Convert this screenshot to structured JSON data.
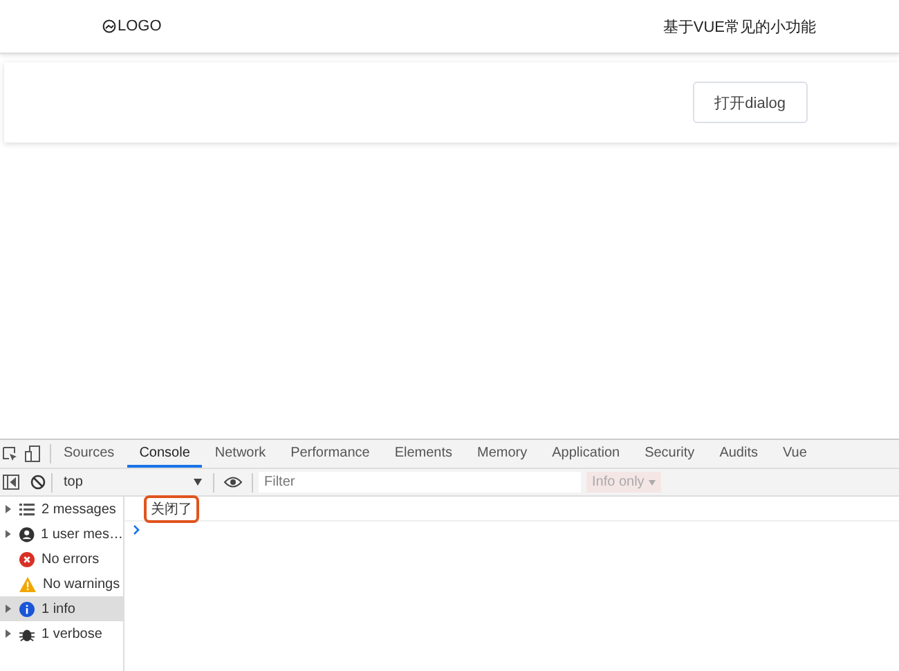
{
  "header": {
    "logo": "LOGO",
    "title": "基于VUE常见的小功能"
  },
  "card": {
    "button": "打开dialog"
  },
  "devtools": {
    "tabs": [
      {
        "label": "Sources",
        "selected": false
      },
      {
        "label": "Console",
        "selected": true
      },
      {
        "label": "Network",
        "selected": false
      },
      {
        "label": "Performance",
        "selected": false
      },
      {
        "label": "Elements",
        "selected": false
      },
      {
        "label": "Memory",
        "selected": false
      },
      {
        "label": "Application",
        "selected": false
      },
      {
        "label": "Security",
        "selected": false
      },
      {
        "label": "Audits",
        "selected": false
      },
      {
        "label": "Vue",
        "selected": false
      }
    ],
    "context": "top",
    "filter": {
      "placeholder": "Filter"
    },
    "levels": "Info only",
    "sidebar": [
      {
        "kind": "list",
        "label": "2 messages",
        "expandable": true,
        "selected": false
      },
      {
        "kind": "user",
        "label": "1 user mes…",
        "expandable": true,
        "selected": false
      },
      {
        "kind": "error",
        "label": "No errors",
        "expandable": false,
        "selected": false
      },
      {
        "kind": "warning",
        "label": "No warnings",
        "expandable": false,
        "selected": false
      },
      {
        "kind": "info",
        "label": "1 info",
        "expandable": true,
        "selected": true
      },
      {
        "kind": "verbose",
        "label": "1 verbose",
        "expandable": true,
        "selected": false
      }
    ],
    "messages": [
      {
        "text": "关闭了",
        "highlighted": true
      }
    ]
  }
}
